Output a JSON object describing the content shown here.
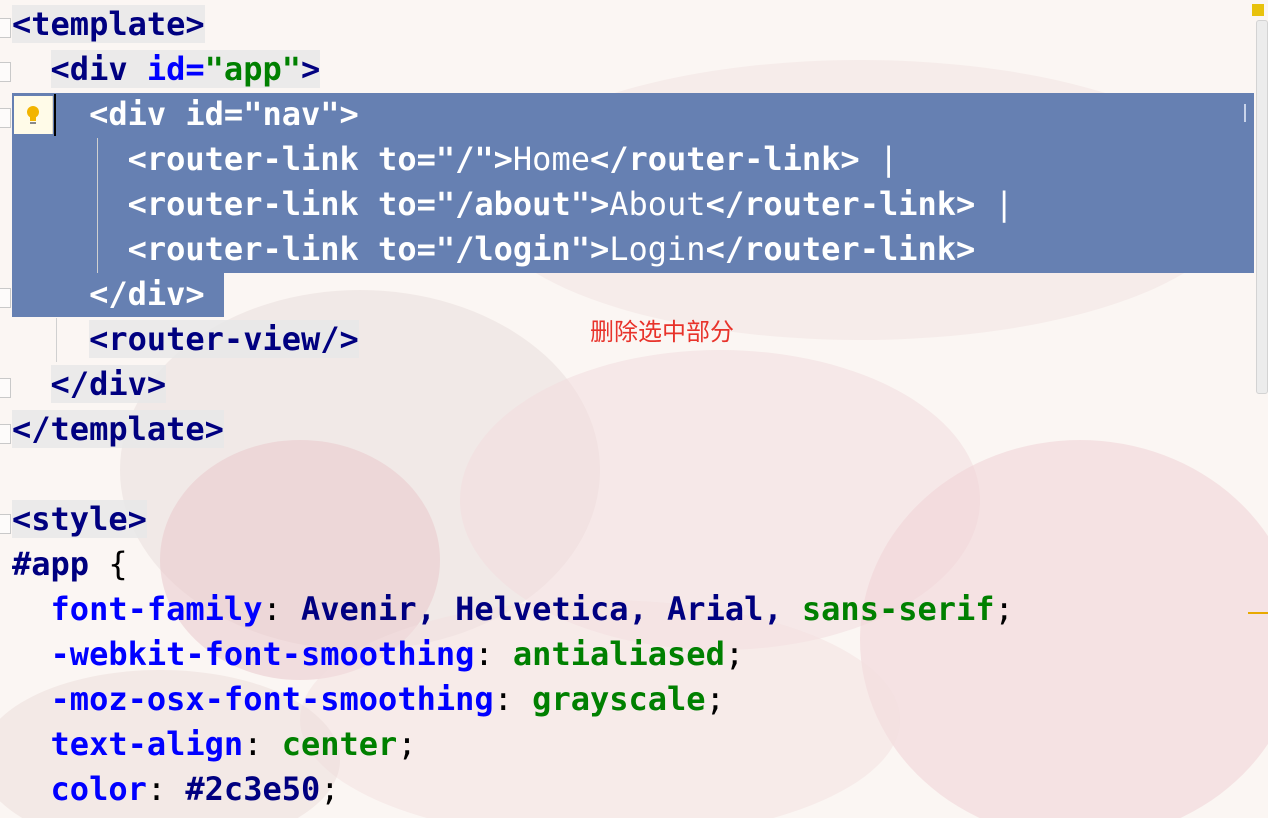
{
  "editor": {
    "language": "vue",
    "annotation": "删除选中部分",
    "colors": {
      "selection": "#6680b2",
      "tag": "#000080",
      "attribute": "#0000ff",
      "string": "#008000",
      "annotation": "#e8332b",
      "indicator": "#e8c20c"
    },
    "lines": [
      {
        "tokens": [
          {
            "t": "<template>",
            "c": "tag",
            "bg": true
          }
        ]
      },
      {
        "tokens": [
          {
            "t": "  "
          },
          {
            "t": "<div",
            "c": "tag",
            "bg": true
          },
          {
            "t": " ",
            "bg": true
          },
          {
            "t": "id=",
            "c": "attr",
            "bg": true
          },
          {
            "t": "\"app\"",
            "c": "str",
            "bg": true
          },
          {
            "t": ">",
            "c": "tag",
            "bg": true
          }
        ]
      },
      {
        "tokens": [
          {
            "t": "    "
          },
          {
            "t": "<div",
            "c": "tag"
          },
          {
            "t": " "
          },
          {
            "t": "id=",
            "c": "attr"
          },
          {
            "t": "\"nav\"",
            "c": "str"
          },
          {
            "t": ">",
            "c": "tag"
          }
        ]
      },
      {
        "tokens": [
          {
            "t": "      "
          },
          {
            "t": "<router-link",
            "c": "tag"
          },
          {
            "t": " "
          },
          {
            "t": "to=",
            "c": "attr"
          },
          {
            "t": "\"/\"",
            "c": "str"
          },
          {
            "t": ">",
            "c": "tag"
          },
          {
            "t": "Home",
            "c": "text"
          },
          {
            "t": "</router-link>",
            "c": "tag"
          },
          {
            "t": " |",
            "c": "text"
          }
        ]
      },
      {
        "tokens": [
          {
            "t": "      "
          },
          {
            "t": "<router-link",
            "c": "tag"
          },
          {
            "t": " "
          },
          {
            "t": "to=",
            "c": "attr"
          },
          {
            "t": "\"/about\"",
            "c": "str"
          },
          {
            "t": ">",
            "c": "tag"
          },
          {
            "t": "About",
            "c": "text"
          },
          {
            "t": "</router-link>",
            "c": "tag"
          },
          {
            "t": " |",
            "c": "text"
          }
        ]
      },
      {
        "tokens": [
          {
            "t": "      "
          },
          {
            "t": "<router-link",
            "c": "tag"
          },
          {
            "t": " "
          },
          {
            "t": "to=",
            "c": "attr"
          },
          {
            "t": "\"/login\"",
            "c": "str"
          },
          {
            "t": ">",
            "c": "tag"
          },
          {
            "t": "Login",
            "c": "text"
          },
          {
            "t": "</router-link>",
            "c": "tag"
          }
        ]
      },
      {
        "tokens": [
          {
            "t": "    "
          },
          {
            "t": "</div>",
            "c": "tag"
          }
        ]
      },
      {
        "tokens": [
          {
            "t": "    "
          },
          {
            "t": "<router-view/>",
            "c": "tag",
            "bg": true
          }
        ]
      },
      {
        "tokens": [
          {
            "t": "  "
          },
          {
            "t": "</div>",
            "c": "tag",
            "bg": true
          }
        ]
      },
      {
        "tokens": [
          {
            "t": "</template>",
            "c": "tag",
            "bg": true
          }
        ]
      },
      {
        "tokens": []
      },
      {
        "tokens": [
          {
            "t": "<style>",
            "c": "tag",
            "bg": true
          }
        ]
      },
      {
        "tokens": [
          {
            "t": "#app",
            "c": "sel"
          },
          {
            "t": " {",
            "c": "plain"
          }
        ]
      },
      {
        "tokens": [
          {
            "t": "  "
          },
          {
            "t": "font-family",
            "c": "prop"
          },
          {
            "t": ": ",
            "c": "plain"
          },
          {
            "t": "Avenir, Helvetica, Arial, ",
            "c": "val"
          },
          {
            "t": "sans-serif",
            "c": "kw"
          },
          {
            "t": ";",
            "c": "plain"
          }
        ]
      },
      {
        "tokens": [
          {
            "t": "  "
          },
          {
            "t": "-webkit-font-smoothing",
            "c": "prop"
          },
          {
            "t": ": ",
            "c": "plain"
          },
          {
            "t": "antialiased",
            "c": "kw"
          },
          {
            "t": ";",
            "c": "plain"
          }
        ]
      },
      {
        "tokens": [
          {
            "t": "  "
          },
          {
            "t": "-moz-osx-font-smoothing",
            "c": "prop"
          },
          {
            "t": ": ",
            "c": "plain"
          },
          {
            "t": "grayscale",
            "c": "kw"
          },
          {
            "t": ";",
            "c": "plain"
          }
        ]
      },
      {
        "tokens": [
          {
            "t": "  "
          },
          {
            "t": "text-align",
            "c": "prop"
          },
          {
            "t": ": ",
            "c": "plain"
          },
          {
            "t": "center",
            "c": "kw"
          },
          {
            "t": ";",
            "c": "plain"
          }
        ]
      },
      {
        "tokens": [
          {
            "t": "  "
          },
          {
            "t": "color",
            "c": "prop"
          },
          {
            "t": ": ",
            "c": "plain"
          },
          {
            "t": "#2c3e50",
            "c": "val"
          },
          {
            "t": ";",
            "c": "plain"
          }
        ]
      }
    ],
    "selected_lines": [
      2,
      3,
      4,
      5,
      6
    ],
    "gutter_icon": "lightbulb-icon"
  }
}
